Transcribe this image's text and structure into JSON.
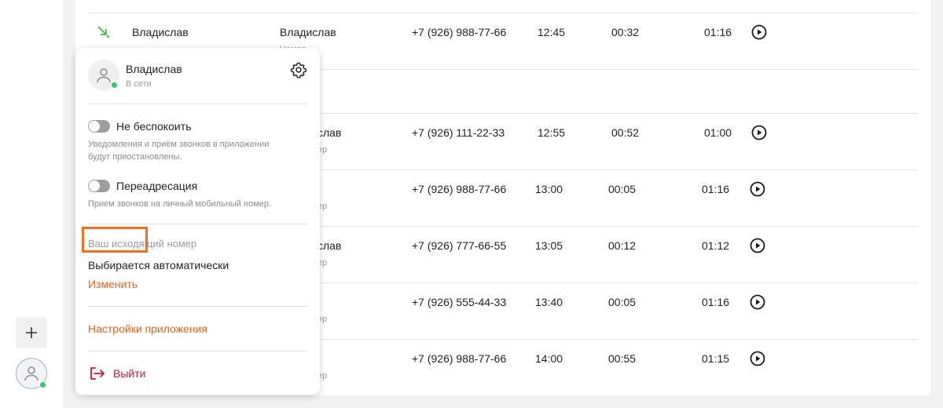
{
  "calls": [
    {
      "name": "Владислав",
      "contact": "Владислав",
      "contact_sub": "Номер",
      "phone": "+7 (926) 988-77-66",
      "time": "12:45",
      "wait": "00:32",
      "duration": "01:16"
    },
    {
      "name": "",
      "contact": "слав",
      "contact_sub": "ер",
      "phone": "+7 (926) 111-22-33",
      "time": "12:55",
      "wait": "00:52",
      "duration": "01:00"
    },
    {
      "name": "",
      "contact": "",
      "contact_sub": "ер",
      "phone": "+7 (926) 988-77-66",
      "time": "13:00",
      "wait": "00:05",
      "duration": "01:16"
    },
    {
      "name": "",
      "contact": "слав",
      "contact_sub": "ер",
      "phone": "+7 (926) 777-66-55",
      "time": "13:05",
      "wait": "00:12",
      "duration": "01:12"
    },
    {
      "name": "",
      "contact": "",
      "contact_sub": "ер",
      "phone": "+7 (926) 555-44-33",
      "time": "13:40",
      "wait": "00:05",
      "duration": "01:16"
    },
    {
      "name": "",
      "contact": "",
      "contact_sub": "ер",
      "phone": "+7 (926) 988-77-66",
      "time": "14:00",
      "wait": "00:55",
      "duration": "01:15"
    }
  ],
  "sidebar": {
    "add_label": "+"
  },
  "popup": {
    "user_name": "Владислав",
    "user_status": "В сети",
    "dnd_label": "Не беспокоить",
    "dnd_desc_1": "Уведомления и приём звонков в приложении",
    "dnd_desc_2": "будут приостановлены.",
    "forward_label": "Переадресация",
    "forward_desc": "Прием звонков на личный мобильный номер.",
    "outgoing_title": "Ваш исходящий номер",
    "outgoing_value": "Выбирается автоматически",
    "change_link": "Изменить",
    "settings_link": "Настройки приложения",
    "logout_label": "Выйти"
  },
  "colors": {
    "accent": "#e8641e",
    "online": "#2ecc71",
    "logout": "#d0152b",
    "incoming_arrow": "#3fbf3f"
  }
}
